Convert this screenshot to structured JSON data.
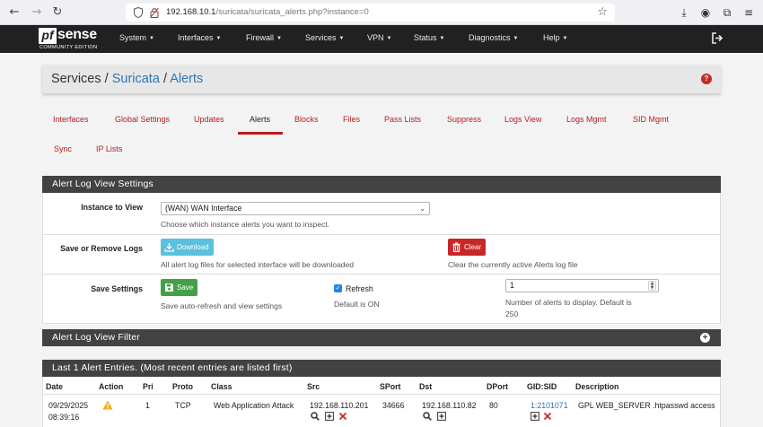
{
  "browser": {
    "url_host": "192.168.10.1",
    "url_path": "/suricata/suricata_alerts.php?instance=0"
  },
  "navbar": {
    "logo_pf": "pf",
    "logo_sense": "sense",
    "logo_edition": "COMMUNITY EDITION",
    "menus": [
      "System",
      "Interfaces",
      "Firewall",
      "Services",
      "VPN",
      "Status",
      "Diagnostics",
      "Help"
    ]
  },
  "breadcrumb": {
    "services": "Services",
    "sep1": "/",
    "suricata": "Suricata",
    "sep2": "/",
    "alerts": "Alerts",
    "help": "?"
  },
  "tabs": [
    "Interfaces",
    "Global Settings",
    "Updates",
    "Alerts",
    "Blocks",
    "Files",
    "Pass Lists",
    "Suppress",
    "Logs View",
    "Logs Mgmt",
    "SID Mgmt",
    "Sync",
    "IP Lists"
  ],
  "active_tab": "Alerts",
  "settings_panel": {
    "title": "Alert Log View Settings",
    "instance_label": "Instance to View",
    "instance_value": "(WAN) WAN Interface",
    "instance_help": "Choose which instance alerts you want to inspect.",
    "save_remove_label": "Save or Remove Logs",
    "download_label": "Download",
    "download_help": "All alert log files for selected interface will be downloaded",
    "clear_label": "Clear",
    "clear_help": "Clear the currently active Alerts log file",
    "save_settings_label": "Save Settings",
    "save_label": "Save",
    "save_help": "Save auto-refresh and view settings",
    "refresh_label": "Refresh",
    "refresh_checked": true,
    "refresh_help": "Default is ON",
    "num_alerts_value": "1",
    "num_alerts_help_line1": "Number of alerts to display. Default is",
    "num_alerts_help_line2": "250"
  },
  "filter_panel": {
    "title": "Alert Log View Filter"
  },
  "alerts_panel": {
    "title": "Last 1 Alert Entries. (Most recent entries are listed first)",
    "columns": [
      "Date",
      "Action",
      "Pri",
      "Proto",
      "Class",
      "Src",
      "SPort",
      "Dst",
      "DPort",
      "GID:SID",
      "Description"
    ],
    "rows": [
      {
        "date": "09/29/2025",
        "time": "08:39:16",
        "pri": "1",
        "proto": "TCP",
        "class": "Web Application Attack",
        "src": "192.168.110.201",
        "sport": "34666",
        "dst": "192.168.110.82",
        "dport": "80",
        "gid_sid": "1:2101071",
        "description": "GPL WEB_SERVER .htpasswd access"
      }
    ]
  },
  "colors": {
    "navbar": "#212121",
    "panel_heading": "#424242",
    "accent_red": "#b71c1c",
    "link_blue": "#2e76b4",
    "btn_info": "#5bc0de",
    "btn_danger": "#c62828",
    "btn_success": "#43a047"
  }
}
